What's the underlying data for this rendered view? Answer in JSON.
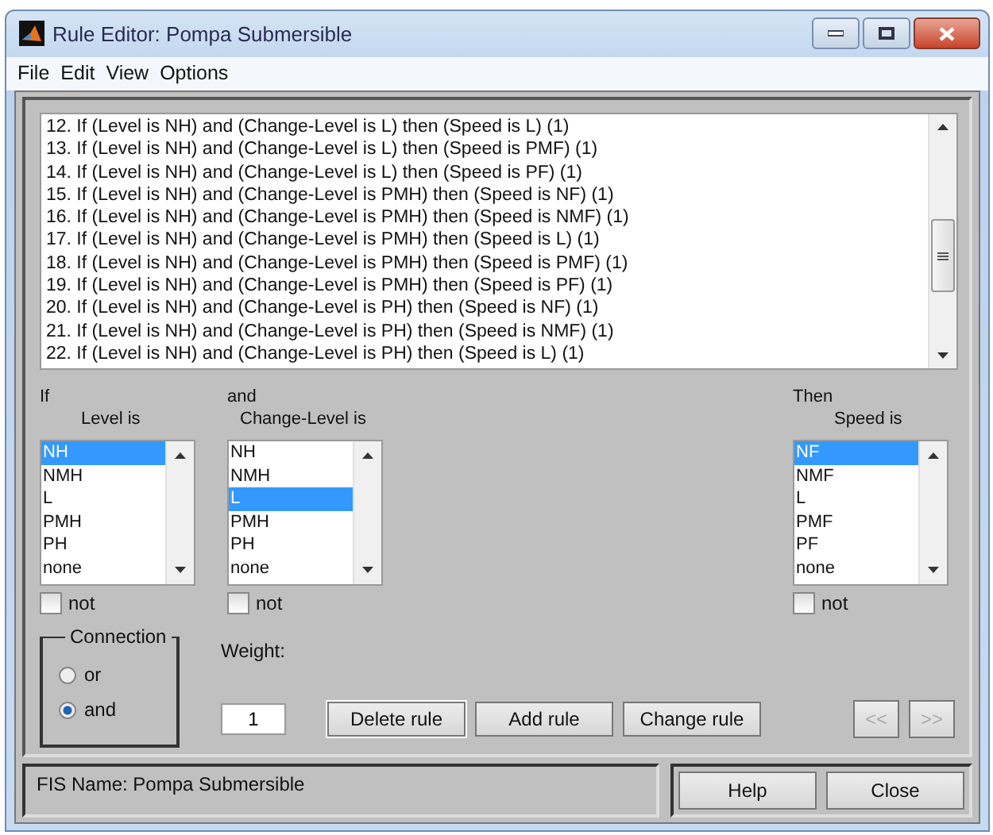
{
  "window": {
    "title": "Rule Editor: Pompa Submersible"
  },
  "menu": [
    "File",
    "Edit",
    "View",
    "Options"
  ],
  "rules": [
    "12. If (Level is NH) and (Change-Level is L) then (Speed is L) (1)",
    "13. If (Level is NH) and (Change-Level is L) then (Speed is PMF) (1)",
    "14. If (Level is NH) and (Change-Level is L) then (Speed is PF) (1)",
    "15. If (Level is NH) and (Change-Level is PMH) then (Speed is NF) (1)",
    "16. If (Level is NH) and (Change-Level is PMH) then (Speed is NMF) (1)",
    "17. If (Level is NH) and (Change-Level is PMH) then (Speed is L) (1)",
    "18. If (Level is NH) and (Change-Level is PMH) then (Speed is PMF) (1)",
    "19. If (Level is NH) and (Change-Level is PMH) then (Speed is PF) (1)",
    "20. If (Level is NH) and (Change-Level is PH) then (Speed is NF) (1)",
    "21. If (Level is NH) and (Change-Level is PH) then (Speed is NMF) (1)",
    "22. If (Level is NH) and (Change-Level is PH) then (Speed is L) (1)"
  ],
  "variables": [
    {
      "kind": "input",
      "header": "If",
      "label": "Level is",
      "not": {
        "label": "not",
        "checked": false
      },
      "options": [
        {
          "label": "NH",
          "selected": true
        },
        {
          "label": "NMH",
          "selected": false
        },
        {
          "label": "L",
          "selected": false
        },
        {
          "label": "PMH",
          "selected": false
        },
        {
          "label": "PH",
          "selected": false
        },
        {
          "label": "none",
          "selected": false
        }
      ]
    },
    {
      "kind": "input",
      "header": "and",
      "label": "Change-Level is",
      "not": {
        "label": "not",
        "checked": false
      },
      "options": [
        {
          "label": "NH",
          "selected": false
        },
        {
          "label": "NMH",
          "selected": false
        },
        {
          "label": "L",
          "selected": true
        },
        {
          "label": "PMH",
          "selected": false
        },
        {
          "label": "PH",
          "selected": false
        },
        {
          "label": "none",
          "selected": false
        }
      ]
    },
    {
      "kind": "output",
      "header": "Then",
      "label": "Speed is",
      "not": {
        "label": "not",
        "checked": false
      },
      "options": [
        {
          "label": "NF",
          "selected": true
        },
        {
          "label": "NMF",
          "selected": false
        },
        {
          "label": "L",
          "selected": false
        },
        {
          "label": "PMF",
          "selected": false
        },
        {
          "label": "PF",
          "selected": false
        },
        {
          "label": "none",
          "selected": false
        }
      ]
    }
  ],
  "connection": {
    "label": "Connection",
    "options": [
      {
        "label": "or",
        "selected": false
      },
      {
        "label": "and",
        "selected": true
      }
    ]
  },
  "weight": {
    "label": "Weight:",
    "value": "1"
  },
  "actions": [
    {
      "label": "Delete rule",
      "disabled": false
    },
    {
      "label": "Add rule",
      "disabled": false
    },
    {
      "label": "Change rule",
      "disabled": false
    }
  ],
  "navigation": [
    {
      "label": "<<",
      "disabled": true
    },
    {
      "label": ">>",
      "disabled": true
    }
  ],
  "status": {
    "text": "FIS Name: Pompa Submersible"
  },
  "footer_buttons": [
    "Help",
    "Close"
  ]
}
